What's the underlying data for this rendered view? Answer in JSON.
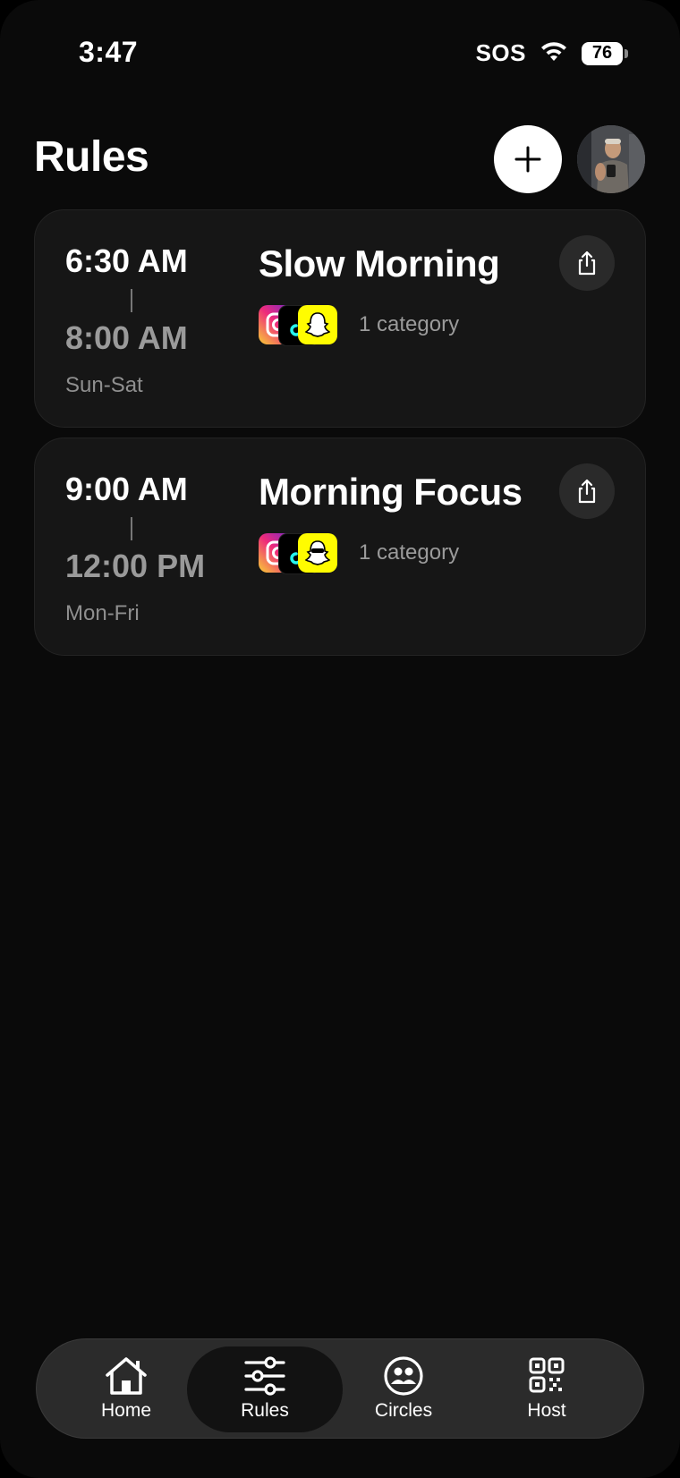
{
  "status_bar": {
    "time": "3:47",
    "carrier": "SOS",
    "battery": "76"
  },
  "header": {
    "title": "Rules",
    "add_icon": "plus-icon",
    "avatar": "profile-photo"
  },
  "rules": [
    {
      "start_time": "6:30 AM",
      "end_time": "8:00 AM",
      "days": "Sun-Sat",
      "name": "Slow Morning",
      "apps": [
        "instagram",
        "tiktok",
        "snapchat"
      ],
      "category": "1 category",
      "share_icon": "share-icon"
    },
    {
      "start_time": "9:00 AM",
      "end_time": "12:00 PM",
      "days": "Mon-Fri",
      "name": "Morning Focus",
      "apps": [
        "instagram",
        "tiktok",
        "snapchat"
      ],
      "category": "1 category",
      "share_icon": "share-icon"
    }
  ],
  "tab_bar": {
    "active": "Rules",
    "tabs": [
      {
        "label": "Home",
        "icon": "house-icon"
      },
      {
        "label": "Rules",
        "icon": "sliders-icon"
      },
      {
        "label": "Circles",
        "icon": "people-circle-icon"
      },
      {
        "label": "Host",
        "icon": "qr-code-icon"
      }
    ]
  },
  "colors": {
    "background": "#0a0a0a",
    "card": "#161616",
    "tab_bar": "#2b2b2b",
    "secondary_text": "#9a9a9a",
    "snapchat_yellow": "#fffc00"
  }
}
